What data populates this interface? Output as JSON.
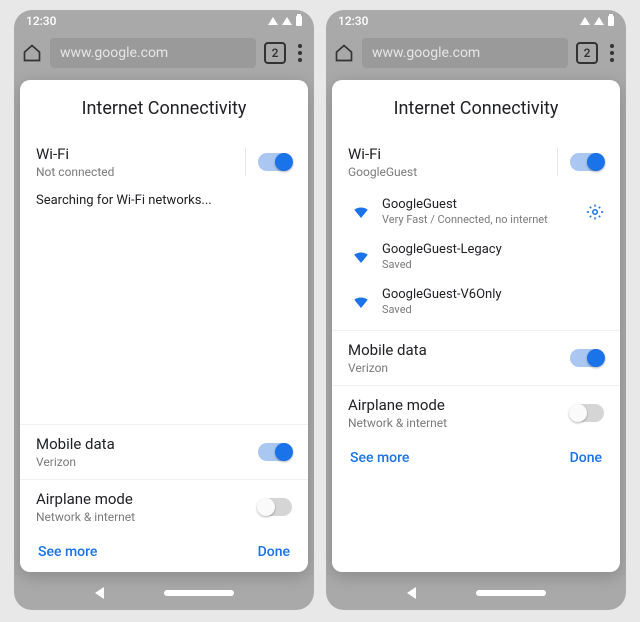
{
  "statusbar": {
    "time": "12:30"
  },
  "browser": {
    "url": "www.google.com",
    "tab_count": "2"
  },
  "sheets": [
    {
      "title": "Internet Connectivity",
      "wifi": {
        "label": "Wi-Fi",
        "sub": "Not connected",
        "on": true
      },
      "searching": "Searching for Wi-Fi networks...",
      "networks": [],
      "mobile": {
        "label": "Mobile data",
        "sub": "Verizon",
        "on": true
      },
      "airplane": {
        "label": "Airplane mode",
        "sub": "Network & internet",
        "on": false
      },
      "see_more": "See more",
      "done": "Done"
    },
    {
      "title": "Internet Connectivity",
      "wifi": {
        "label": "Wi-Fi",
        "sub": "GoogleGuest",
        "on": true
      },
      "networks": [
        {
          "name": "GoogleGuest",
          "detail": "Very Fast / Connected, no internet",
          "gear": true
        },
        {
          "name": "GoogleGuest-Legacy",
          "detail": "Saved",
          "gear": false
        },
        {
          "name": "GoogleGuest-V6Only",
          "detail": "Saved",
          "gear": false
        }
      ],
      "mobile": {
        "label": "Mobile data",
        "sub": "Verizon",
        "on": true
      },
      "airplane": {
        "label": "Airplane mode",
        "sub": "Network & internet",
        "on": false
      },
      "see_more": "See more",
      "done": "Done"
    }
  ]
}
